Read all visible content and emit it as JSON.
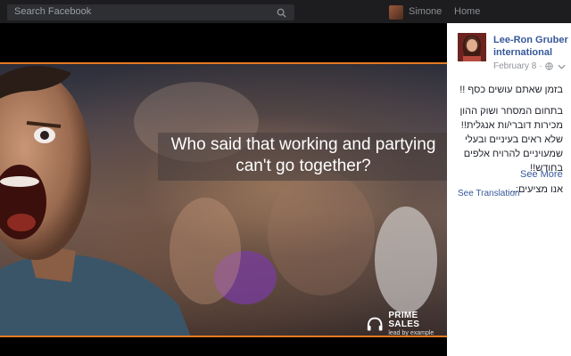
{
  "topbar": {
    "search_text": "Search Facebook",
    "user_name": "Simone",
    "home_label": "Home"
  },
  "image": {
    "caption_line1": "Who said that working and partying",
    "caption_line2": "can't go together?",
    "logo_title": "PRIME SALES",
    "logo_sub": "lead by example"
  },
  "post": {
    "author_line1": "Lee-Ron Gruber",
    "author_line2": "international",
    "date": "February 8",
    "line1": "בזמן שאתם עושים כסף !!",
    "line2": "בתחום המסחר ושוק ההון מכירות דוברי/ות אנגלית!! שלא ראים בעיניים ובעלי שמעויניים להרויח אלפים בחודש!!",
    "line3": "אנו מציעים:...",
    "see_more": "See More",
    "see_translation": "See Translation"
  },
  "colors": {
    "accent_orange": "#e57a22",
    "link_blue": "#365899",
    "topbar": "#1d1d1f"
  },
  "icons": [
    "search-icon",
    "globe-icon",
    "chevron-down-icon",
    "headset-icon"
  ]
}
